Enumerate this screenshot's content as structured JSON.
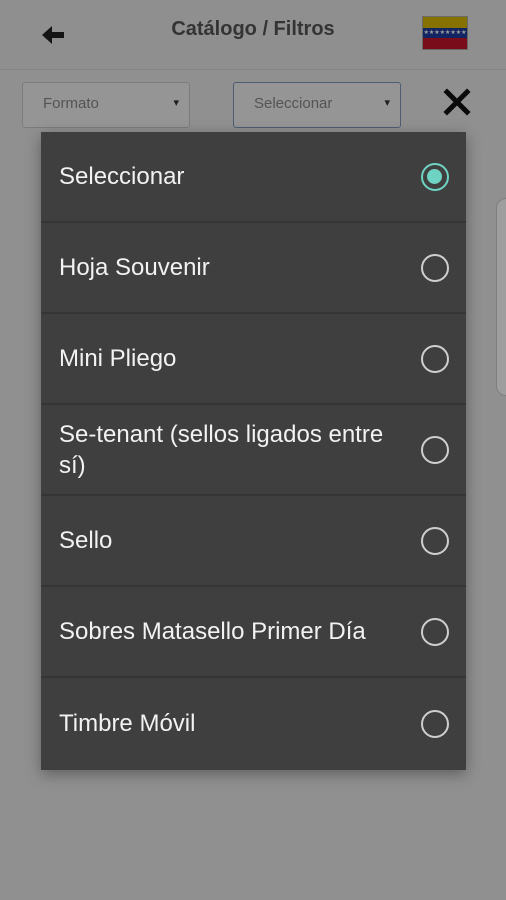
{
  "header": {
    "title": "Catálogo / Filtros",
    "back_icon": "arrow-left-icon",
    "flag_icon": "venezuela-flag-icon"
  },
  "filters": {
    "format_placeholder": "Formato",
    "type_selected": "Seleccionar",
    "caret": "▾",
    "clear_icon": "close-x-icon"
  },
  "menu": {
    "accent_color": "#6fd3c4",
    "items": [
      {
        "label": "Seleccionar",
        "selected": true
      },
      {
        "label": "Hoja Souvenir",
        "selected": false
      },
      {
        "label": "Mini Pliego",
        "selected": false
      },
      {
        "label": "Se-tenant (sellos ligados entre sí)",
        "selected": false
      },
      {
        "label": "Sello",
        "selected": false
      },
      {
        "label": "Sobres Matasello Primer Día",
        "selected": false
      },
      {
        "label": "Timbre Móvil",
        "selected": false
      }
    ]
  }
}
